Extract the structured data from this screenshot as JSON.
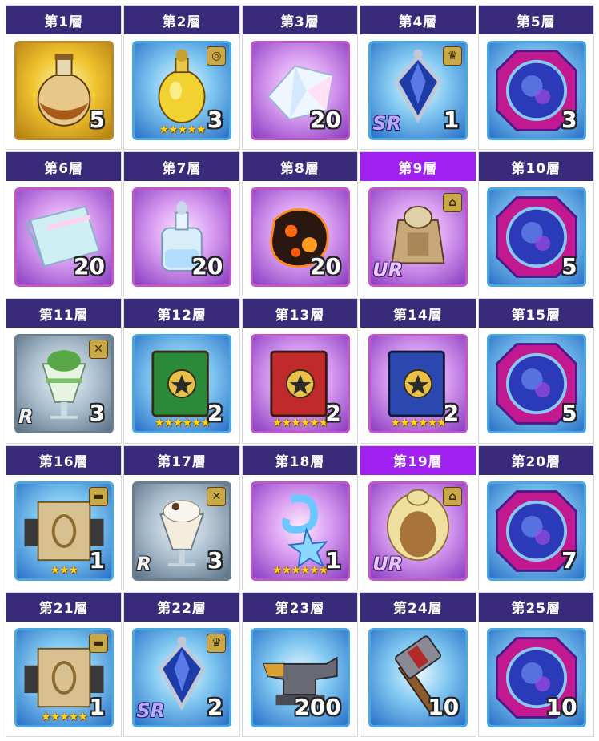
{
  "cells": [
    {
      "floor": "第1層",
      "qty": "5",
      "bg": "gold",
      "art": "potion-brown",
      "stars": "",
      "rarity": "",
      "badge": ""
    },
    {
      "floor": "第2層",
      "qty": "3",
      "bg": "blue",
      "art": "potion-gold",
      "stars": "★★★★★",
      "rarity": "",
      "badge": "ring"
    },
    {
      "floor": "第3層",
      "qty": "20",
      "bg": "purple",
      "art": "crystal",
      "stars": "",
      "rarity": "",
      "badge": ""
    },
    {
      "floor": "第4層",
      "qty": "1",
      "bg": "blue",
      "art": "pendant",
      "stars": "",
      "rarity": "SR",
      "badge": "crown"
    },
    {
      "floor": "第5層",
      "qty": "3",
      "bg": "blue",
      "art": "orb",
      "stars": "",
      "rarity": "",
      "badge": ""
    },
    {
      "floor": "第6層",
      "qty": "20",
      "bg": "purple",
      "art": "cloth",
      "stars": "",
      "rarity": "",
      "badge": ""
    },
    {
      "floor": "第7層",
      "qty": "20",
      "bg": "purple",
      "art": "bottle",
      "stars": "",
      "rarity": "",
      "badge": ""
    },
    {
      "floor": "第8層",
      "qty": "20",
      "bg": "purple",
      "art": "lava",
      "stars": "",
      "rarity": "",
      "badge": ""
    },
    {
      "floor": "第9層",
      "qty": "",
      "bg": "purple",
      "art": "armor",
      "stars": "",
      "rarity": "UR",
      "badge": "hanger",
      "highlight": true
    },
    {
      "floor": "第10層",
      "qty": "5",
      "bg": "blue",
      "art": "orb",
      "stars": "",
      "rarity": "",
      "badge": ""
    },
    {
      "floor": "第11層",
      "qty": "3",
      "bg": "grey",
      "art": "parfait-green",
      "stars": "",
      "rarity": "R",
      "badge": "utensils"
    },
    {
      "floor": "第12層",
      "qty": "2",
      "bg": "blue",
      "art": "book-green",
      "stars": "★★★★★★",
      "rarity": "",
      "badge": ""
    },
    {
      "floor": "第13層",
      "qty": "2",
      "bg": "purple",
      "art": "book-red",
      "stars": "★★★★★★",
      "rarity": "",
      "badge": ""
    },
    {
      "floor": "第14層",
      "qty": "2",
      "bg": "purple",
      "art": "book-blue",
      "stars": "★★★★★★",
      "rarity": "",
      "badge": ""
    },
    {
      "floor": "第15層",
      "qty": "5",
      "bg": "blue",
      "art": "orb",
      "stars": "",
      "rarity": "",
      "badge": ""
    },
    {
      "floor": "第16層",
      "qty": "1",
      "bg": "blue",
      "art": "scroll",
      "stars": "★★★",
      "rarity": "",
      "badge": "dumbbell"
    },
    {
      "floor": "第17層",
      "qty": "3",
      "bg": "grey",
      "art": "parfait-white",
      "stars": "",
      "rarity": "R",
      "badge": "utensils"
    },
    {
      "floor": "第18層",
      "qty": "1",
      "bg": "purple",
      "art": "ice",
      "stars": "★★★★★★",
      "rarity": "",
      "badge": ""
    },
    {
      "floor": "第19層",
      "qty": "",
      "bg": "purple",
      "art": "hair",
      "stars": "",
      "rarity": "UR",
      "badge": "hanger",
      "highlight": true
    },
    {
      "floor": "第20層",
      "qty": "7",
      "bg": "blue",
      "art": "orb",
      "stars": "",
      "rarity": "",
      "badge": ""
    },
    {
      "floor": "第21層",
      "qty": "1",
      "bg": "blue",
      "art": "scroll",
      "stars": "★★★★★",
      "rarity": "",
      "badge": "dumbbell"
    },
    {
      "floor": "第22層",
      "qty": "2",
      "bg": "blue",
      "art": "pendant",
      "stars": "",
      "rarity": "SR",
      "badge": "crown"
    },
    {
      "floor": "第23層",
      "qty": "200",
      "bg": "blue",
      "art": "anvil",
      "stars": "",
      "rarity": "",
      "badge": ""
    },
    {
      "floor": "第24層",
      "qty": "10",
      "bg": "blue",
      "art": "hammer",
      "stars": "",
      "rarity": "",
      "badge": ""
    },
    {
      "floor": "第25層",
      "qty": "10",
      "bg": "blue",
      "art": "orb",
      "stars": "",
      "rarity": "",
      "badge": ""
    }
  ]
}
